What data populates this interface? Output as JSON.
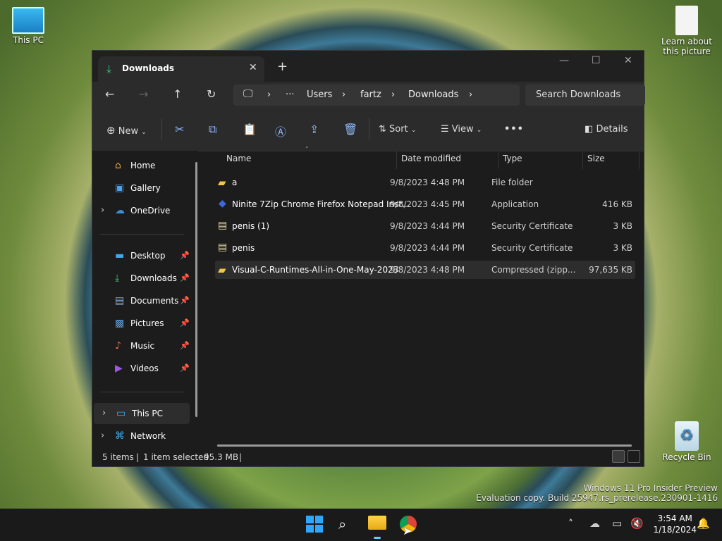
{
  "desktop": {
    "this_pc": "This PC",
    "learn": "Learn about this picture",
    "recycle": "Recycle Bin",
    "watermark_line1": "Windows 11 Pro Insider Preview",
    "watermark_line2": "Evaluation copy. Build 25947.rs_prerelease.230901-1416"
  },
  "window": {
    "tab_title": "Downloads",
    "search_placeholder": "Search Downloads",
    "breadcrumb": [
      "Users",
      "fartz",
      "Downloads"
    ],
    "ellipsis": "···"
  },
  "commandbar": {
    "new_label": "New",
    "sort_label": "Sort",
    "view_label": "View",
    "details_label": "Details"
  },
  "navpane": {
    "home": "Home",
    "gallery": "Gallery",
    "onedrive": "OneDrive",
    "desktop": "Desktop",
    "downloads": "Downloads",
    "documents": "Documents",
    "pictures": "Pictures",
    "music": "Music",
    "videos": "Videos",
    "thispc": "This PC",
    "network": "Network"
  },
  "columns": {
    "name": "Name",
    "date": "Date modified",
    "type": "Type",
    "size": "Size"
  },
  "files": [
    {
      "name": "a",
      "date": "9/8/2023 4:48 PM",
      "type": "File folder",
      "size": ""
    },
    {
      "name": "Ninite 7Zip Chrome Firefox Notepad Inst...",
      "date": "9/8/2023 4:45 PM",
      "type": "Application",
      "size": "416 KB"
    },
    {
      "name": "penis (1)",
      "date": "9/8/2023 4:44 PM",
      "type": "Security Certificate",
      "size": "3 KB"
    },
    {
      "name": "penis",
      "date": "9/8/2023 4:44 PM",
      "type": "Security Certificate",
      "size": "3 KB"
    },
    {
      "name": "Visual-C-Runtimes-All-in-One-May-2023",
      "date": "9/8/2023 4:48 PM",
      "type": "Compressed (zipp...",
      "size": "97,635 KB"
    }
  ],
  "status": {
    "items": "5 items",
    "selected": "1 item selected",
    "size": "95.3 MB"
  },
  "taskbar": {
    "time": "3:54 AM",
    "date": "1/18/2024"
  }
}
